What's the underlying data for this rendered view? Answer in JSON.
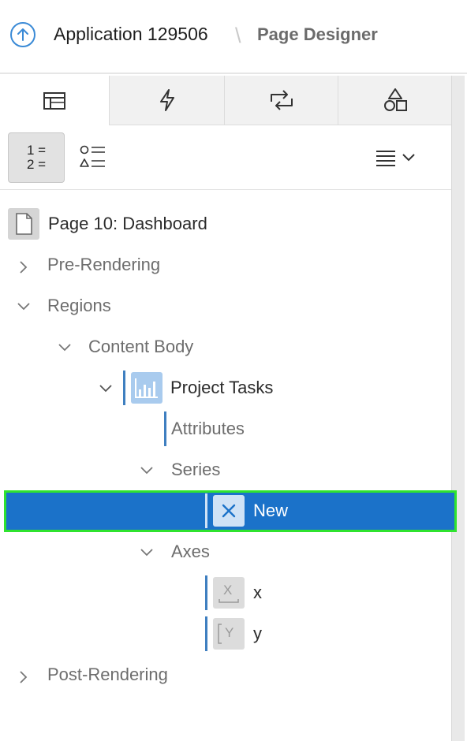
{
  "header": {
    "app_title": "Application 129506",
    "separator": "\\",
    "page_title": "Page Designer"
  },
  "tabs": [
    {
      "name": "rendering",
      "icon": "grid-layout-icon",
      "active": true
    },
    {
      "name": "dynamic-actions",
      "icon": "lightning-icon",
      "active": false
    },
    {
      "name": "processing",
      "icon": "arrows-cycle-icon",
      "active": false
    },
    {
      "name": "shared-components",
      "icon": "shapes-icon",
      "active": false
    }
  ],
  "toolbar": {
    "numbered_view_top": "1 =",
    "numbered_view_bottom": "2 =",
    "component_view_icon": "shapes-list-icon",
    "menu_icon": "hamburger-menu-icon"
  },
  "tree": {
    "root": "Page 10: Dashboard",
    "pre_rendering": "Pre-Rendering",
    "regions": "Regions",
    "content_body": "Content Body",
    "project_tasks": "Project Tasks",
    "attributes": "Attributes",
    "series": "Series",
    "new_series": "New",
    "axes": "Axes",
    "axis_x": "x",
    "axis_y": "y",
    "post_rendering": "Post-Rendering",
    "x_axis_glyph": "X",
    "y_axis_glyph": "Y"
  },
  "colors": {
    "selected_bg": "#1b72c9",
    "highlight_border": "#2fe32f",
    "accent": "#3a8ad6"
  }
}
